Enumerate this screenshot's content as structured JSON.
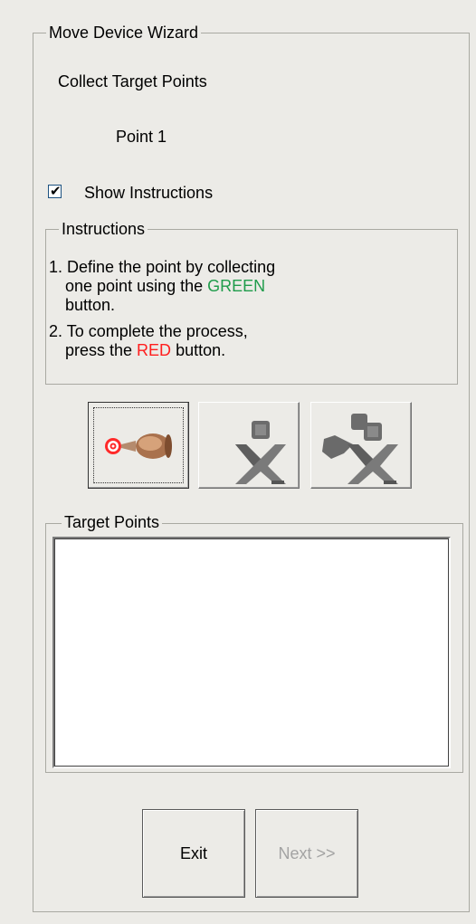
{
  "wizard": {
    "title": "Move Device Wizard",
    "step_title": "Collect Target Points",
    "point_label": "Point 1",
    "show_instructions": {
      "label": "Show Instructions",
      "checked": true
    }
  },
  "instructions": {
    "title": "Instructions",
    "steps": [
      {
        "num": "1.",
        "line1": "Define the point by collecting",
        "line2a": "one point using the ",
        "highlight": "GREEN",
        "line3": "button."
      },
      {
        "num": "2.",
        "line1": "To complete the process,",
        "line2a": "press the ",
        "highlight": "RED",
        "line2b": " button."
      }
    ]
  },
  "toolbar": {
    "buttons": [
      {
        "icon": "probe-target-icon"
      },
      {
        "icon": "single-figure-icon"
      },
      {
        "icon": "double-figure-icon"
      }
    ]
  },
  "target_points": {
    "title": "Target Points",
    "items": []
  },
  "footer": {
    "exit_label": "Exit",
    "next_label": "Next >>"
  },
  "colors": {
    "green": "#1f9c4b",
    "red": "#ff1e1e",
    "panel": "#ecebe7"
  }
}
